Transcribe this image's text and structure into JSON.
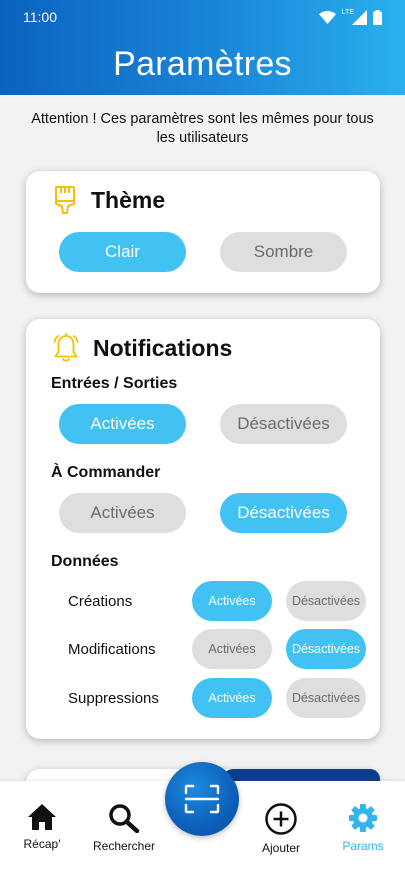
{
  "status_bar": {
    "time": "11:00",
    "network_label": "LTE"
  },
  "header": {
    "title": "Paramètres"
  },
  "warning": "Attention ! Ces paramètres sont les mêmes pour tous les utilisateurs",
  "theme": {
    "title": "Thème",
    "options": {
      "light": "Clair",
      "dark": "Sombre"
    },
    "selected": "Clair"
  },
  "notifications": {
    "title": "Notifications",
    "entries_exits": {
      "label": "Entrées / Sorties",
      "on": "Activées",
      "off": "Désactivées",
      "selected": "Activées"
    },
    "to_order": {
      "label": "À Commander",
      "on": "Activées",
      "off": "Désactivées",
      "selected": "Désactivées"
    },
    "data": {
      "label": "Données",
      "rows": [
        {
          "label": "Créations",
          "on": "Activées",
          "off": "Désactivées",
          "selected": "Activées"
        },
        {
          "label": "Modifications",
          "on": "Activées",
          "off": "Désactivées",
          "selected": "Désactivées"
        },
        {
          "label": "Suppressions",
          "on": "Activées",
          "off": "Désactivées",
          "selected": "Activées"
        }
      ]
    }
  },
  "bottom_nav": {
    "items": [
      {
        "label": "Récap'",
        "icon": "home-icon"
      },
      {
        "label": "Rechercher",
        "icon": "search-icon"
      },
      {
        "label": "",
        "icon": "scan-icon"
      },
      {
        "label": "Ajouter",
        "icon": "add-circle-icon"
      },
      {
        "label": "Params",
        "icon": "gear-icon"
      }
    ],
    "active": "Params"
  },
  "colors": {
    "accent": "#42c1f3",
    "inactive": "#dedede",
    "header_start": "#0a63bf",
    "header_end": "#2ab0ee",
    "icon_yellow": "#f2c200",
    "scan_button": "#0d5fb8"
  }
}
